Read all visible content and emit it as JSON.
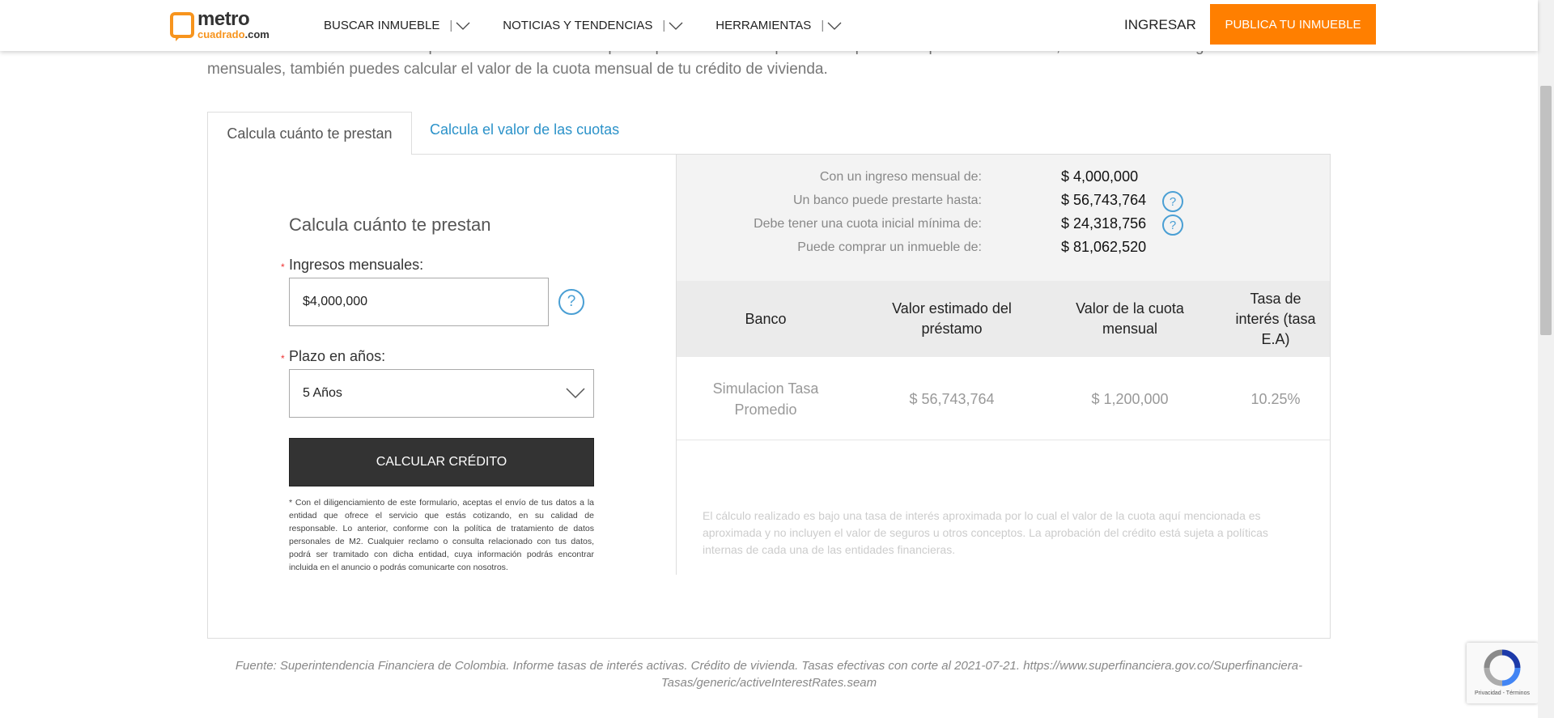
{
  "header": {
    "logo_top": "metro",
    "logo_bottom": "cuadrado",
    "logo_suffix": ".com",
    "nav": [
      {
        "label": "BUSCAR INMUEBLE"
      },
      {
        "label": "NOTICIAS Y TENDENCIAS"
      },
      {
        "label": "HERRAMIENTAS"
      }
    ],
    "nav_separator": "|",
    "login": "INGRESAR",
    "publish": "PUBLICA TU INMUEBLE"
  },
  "intro": "En nuestro simulador de crédito puedes calcular cuánto te puede prestar un banco para la compra de tu apartamento o casa, de acuerdo a tus ingresos mensuales, también puedes calcular el valor de la cuota mensual de tu crédito de vivienda.",
  "tabs": [
    {
      "label": "Calcula cuánto te prestan"
    },
    {
      "label": "Calcula el valor de las cuotas"
    }
  ],
  "form": {
    "title": "Calcula cuánto te prestan",
    "required_mark": "*",
    "income_label": "Ingresos mensuales:",
    "income_value": "$4,000,000",
    "help_glyph": "?",
    "term_label": "Plazo en años:",
    "term_value": "5 Años",
    "submit": "CALCULAR CRÉDITO",
    "disclaimer": "* Con el diligenciamiento de este formulario, aceptas el envío de tus datos a la entidad que ofrece el servicio que estás cotizando, en su calidad de responsable. Lo anterior, conforme con la política de tratamiento de datos personales de M2. Cualquier reclamo o consulta relacionado con tus datos, podrá ser tramitado con dicha entidad, cuya información podrás encontrar incluida en el anuncio o podrás comunicarte con nosotros."
  },
  "summary": [
    {
      "label": "Con un ingreso mensual de:",
      "value": "$ 4,000,000"
    },
    {
      "label": "Un banco puede prestarte hasta:",
      "value": "$ 56,743,764"
    },
    {
      "label": "Debe tener una cuota inicial mínima de:",
      "value": "$ 24,318,756"
    },
    {
      "label": "Puede comprar un inmueble de:",
      "value": "$ 81,062,520"
    }
  ],
  "table": {
    "headers": [
      "Banco",
      "Valor estimado del préstamo",
      "Valor de la cuota mensual",
      "Tasa de interés (tasa E.A)"
    ],
    "rows": [
      [
        "Simulacion Tasa Promedio",
        "$ 56,743,764",
        "$ 1,200,000",
        "10.25%"
      ]
    ]
  },
  "note": "El cálculo realizado es bajo una tasa de interés aproximada por lo cual el valor de la cuota aquí mencionada es aproximada y no incluyen el valor de seguros u otros conceptos. La aprobación del crédito está sujeta a políticas internas de cada una de las entidades financieras.",
  "footer_source": "Fuente: Superintendencia Financiera de Colombia. Informe tasas de interés activas. Crédito de vivienda. Tasas efectivas con corte al 2021-07-21. https://www.superfinanciera.gov.co/Superfinanciera-Tasas/generic/activeInterestRates.seam",
  "recaptcha": {
    "text": "Privacidad - Términos"
  },
  "colors": {
    "accent": "#ff7f00",
    "link": "#2b92c9",
    "button_dark": "#333333"
  }
}
